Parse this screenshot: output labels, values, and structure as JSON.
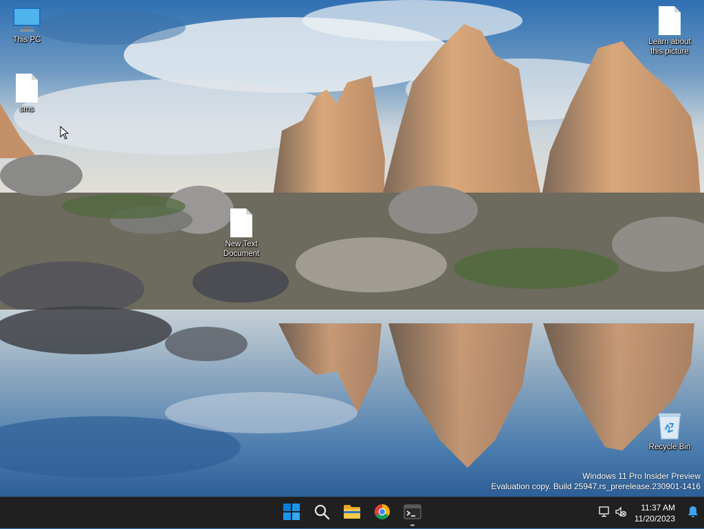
{
  "desktop": {
    "icons": [
      {
        "label": "This PC",
        "icon": "monitor-icon"
      },
      {
        "label": "sms",
        "icon": "text-file-icon"
      },
      {
        "label": "New Text Document",
        "icon": "text-file-icon"
      },
      {
        "label": "Learn about this picture",
        "icon": "text-file-icon"
      },
      {
        "label": "Recycle Bin",
        "icon": "recycle-bin-icon"
      }
    ],
    "watermark": {
      "line1": "Windows 11 Pro Insider Preview",
      "line2": "Evaluation copy. Build 25947.rs_prerelease.230901-1416"
    }
  },
  "taskbar": {
    "apps": [
      {
        "name": "Start",
        "icon": "windows-logo-icon"
      },
      {
        "name": "Search",
        "icon": "search-icon"
      },
      {
        "name": "File Explorer",
        "icon": "folder-icon"
      },
      {
        "name": "Google Chrome",
        "icon": "chrome-icon"
      },
      {
        "name": "Terminal",
        "icon": "terminal-icon",
        "running": true
      }
    ],
    "tray": {
      "time": "11:37 AM",
      "date": "11/20/2023"
    },
    "accent": "#0a7fd8"
  }
}
